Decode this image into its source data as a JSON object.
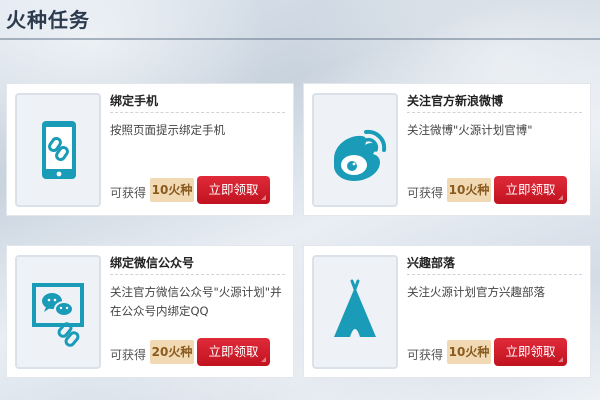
{
  "page": {
    "title": "火种任务"
  },
  "colors": {
    "accent": "#1a9bb8",
    "button": "#d01b2c",
    "badge": "#f0d9b3"
  },
  "tasks": [
    {
      "icon": "phone-link-icon",
      "title": "绑定手机",
      "desc": "按照页面提示绑定手机",
      "reward_label": "可获得",
      "reward": "10火种",
      "button": "立即领取"
    },
    {
      "icon": "weibo-icon",
      "title": "关注官方新浪微博",
      "desc": "关注微博\"火源计划官博\"",
      "reward_label": "可获得",
      "reward": "10火种",
      "button": "立即领取"
    },
    {
      "icon": "wechat-icon",
      "title": "绑定微信公众号",
      "desc": "关注官方微信公众号\"火源计划\"并在公众号内绑定QQ",
      "reward_label": "可获得",
      "reward": "20火种",
      "button": "立即领取"
    },
    {
      "icon": "tent-icon",
      "title": "兴趣部落",
      "desc": "关注火源计划官方兴趣部落",
      "reward_label": "可获得",
      "reward": "10火种",
      "button": "立即领取"
    }
  ]
}
